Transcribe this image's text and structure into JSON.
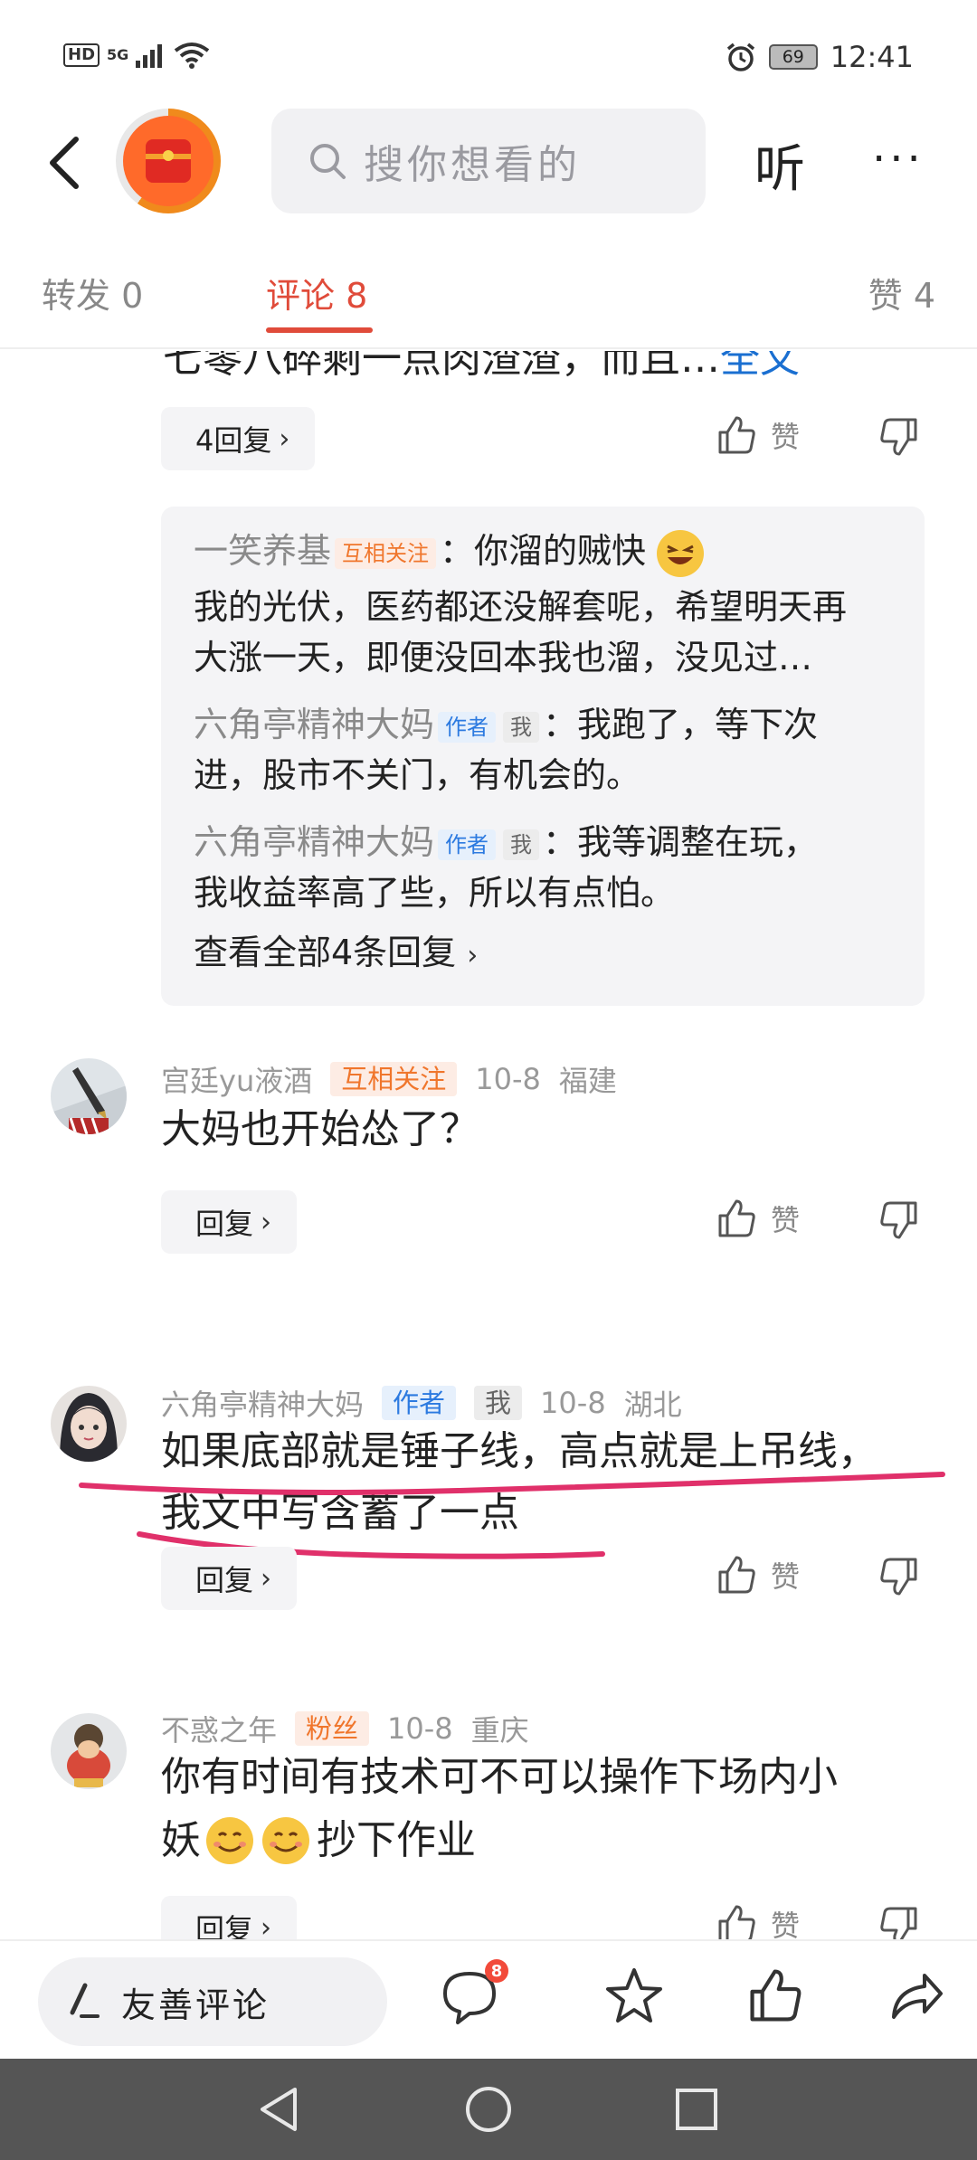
{
  "status_bar": {
    "network": "HD",
    "signal": "5G",
    "battery": "69",
    "time": "12:41"
  },
  "header": {
    "search_placeholder": "搜你想看的",
    "listen_label": "听",
    "more_label": "···"
  },
  "tabs": {
    "forward": "转发 0",
    "comment": "评论 8",
    "like": "赞 4"
  },
  "top_comment": {
    "cut_text": "七零八碎剩一点肉渣渣，而且…",
    "full_text_link": "全文",
    "reply_count_label": "4回复",
    "like_label": "赞"
  },
  "reply_box": {
    "r1_name": "一笑养基",
    "r1_tag": "互相关注",
    "r1_text": "：你溜的贼快",
    "r1_line2": "我的光伏，医药都还没解套呢，希望明天再",
    "r1_line3": "大涨一天，即便没回本我也溜，没见过…",
    "r2_name": "六角亭精神大妈",
    "r2_tag": "作者",
    "r2_tag2": "我",
    "r2_text": "：我跑了，等下次",
    "r2_line2": "进，股市不关门，有机会的。",
    "r3_name": "六角亭精神大妈",
    "r3_tag": "作者",
    "r3_tag2": "我",
    "r3_text": "：我等调整在玩，",
    "r3_line2": "我收益率高了些，所以有点怕。",
    "view_all": "查看全部4条回复"
  },
  "comments": [
    {
      "user": "宫廷yu液酒",
      "tag": "互相关注",
      "date": "10-8",
      "location": "福建",
      "text_line1": "大妈也开始怂了？",
      "text_line2": "",
      "reply_label": "回复",
      "like_label": "赞"
    },
    {
      "user": "六角亭精神大妈",
      "tag": "作者",
      "tag2": "我",
      "date": "10-8",
      "location": "湖北",
      "text_line1": "如果底部就是锤子线，高点就是上吊线，",
      "text_line2": "我文中写含蓄了一点",
      "reply_label": "回复",
      "like_label": "赞"
    },
    {
      "user": "不惑之年",
      "tag": "粉丝",
      "date": "10-8",
      "location": "重庆",
      "text_line1": "你有时间有技术可不可以操作下场内小",
      "text_line2_post": "抄下作业",
      "reply_label": "回复",
      "like_label": "赞"
    }
  ],
  "bottom_bar": {
    "write_placeholder": "友善评论",
    "comment_badge": "8"
  },
  "colors": {
    "accent_red": "#e04b3a",
    "link_blue": "#1a6fd1",
    "mutual_tag": "#f0762c",
    "author_tag": "#2c7ae0",
    "annotation_pink": "#e0306a"
  }
}
